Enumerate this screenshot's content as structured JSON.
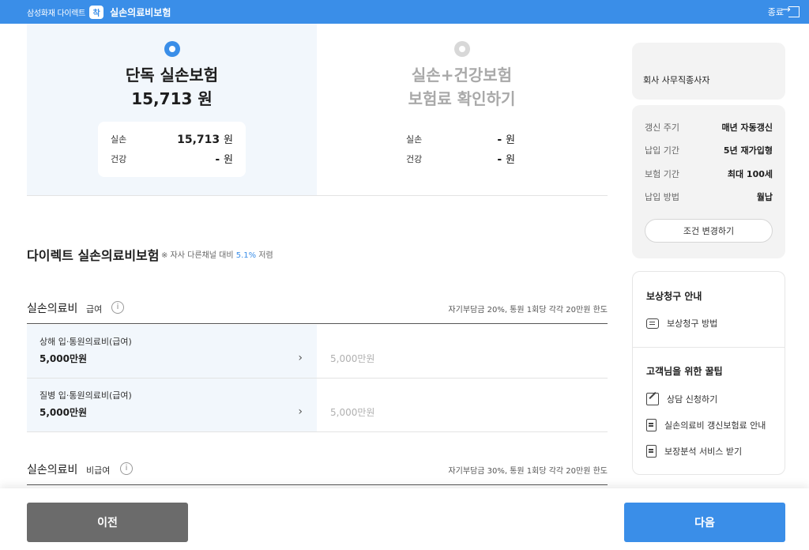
{
  "topbar": {
    "brand": "삼성화재 다이렉트",
    "brand_badge": "착",
    "product": "실손의료비보험",
    "exit_label": "종료"
  },
  "plans": [
    {
      "title": "단독 실손보험",
      "price": "15,713 원",
      "rows": [
        {
          "label": "실손",
          "value": "15,713",
          "unit": "원"
        },
        {
          "label": "건강",
          "value": "-",
          "unit": "원"
        }
      ]
    },
    {
      "title": "실손+건강보험",
      "price": "보험료 확인하기",
      "rows": [
        {
          "label": "실손",
          "value": "-",
          "unit": "원"
        },
        {
          "label": "건강",
          "value": "-",
          "unit": "원"
        }
      ]
    }
  ],
  "section": {
    "title": "다이렉트 실손의료비보험",
    "note_prefix": "※ 자사 다른채널 대비",
    "note_pct": "5.1%",
    "note_suffix": "저렴"
  },
  "categories": [
    {
      "name": "실손의료비",
      "sub": "급여",
      "info": "i",
      "note": "자기부담금 20%, 통원 1회당 각각 20만원 한도",
      "items": [
        {
          "name": "상해 입·통원의료비(급여)",
          "value": "5,000만원",
          "other": "5,000만원"
        },
        {
          "name": "질병 입·통원의료비(급여)",
          "value": "5,000만원",
          "other": "5,000만원"
        }
      ]
    },
    {
      "name": "실손의료비",
      "sub": "비급여",
      "info": "i",
      "note": "자기부담금 30%, 통원 1회당 각각 20만원 한도"
    }
  ],
  "sidebar": {
    "job": "회사 사무직종사자",
    "conditions": [
      {
        "label": "갱신 주기",
        "value": "매년 자동갱신"
      },
      {
        "label": "납입 기간",
        "value": "5년 재가입형"
      },
      {
        "label": "보험 기간",
        "value": "최대 100세"
      },
      {
        "label": "납입 방법",
        "value": "월납"
      }
    ],
    "change_label": "조건 변경하기",
    "claim_heading": "보상청구 안내",
    "claim_item": "보상청구 방법",
    "tips_heading": "고객님을 위한 꿀팁",
    "tips": [
      "상담 신청하기",
      "실손의료비 갱신보험료 안내",
      "보장분석 서비스 받기"
    ]
  },
  "nav": {
    "prev": "이전",
    "next": "다음"
  },
  "colors": {
    "accent": "#3a8ee8",
    "selected_bg": "#f2f7fc",
    "prev_button": "#6b6b6b"
  },
  "icons": [
    "exit-icon",
    "radio-selected-icon",
    "radio-unselected-icon",
    "info-icon",
    "chevron-right-icon",
    "chat-icon",
    "edit-icon",
    "document-icon"
  ]
}
